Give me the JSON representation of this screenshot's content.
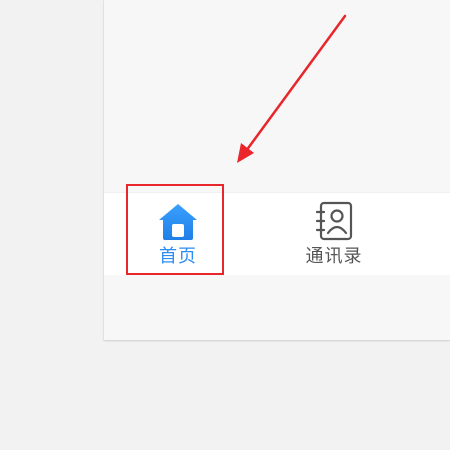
{
  "tabbar": {
    "tabs": [
      {
        "label": "首页",
        "icon": "home-icon",
        "active": true
      },
      {
        "label": "通讯录",
        "icon": "contacts-icon",
        "active": false
      }
    ]
  },
  "colors": {
    "active": "#2d8ef0",
    "inactive": "#555555",
    "annotation": "#e8262b"
  }
}
